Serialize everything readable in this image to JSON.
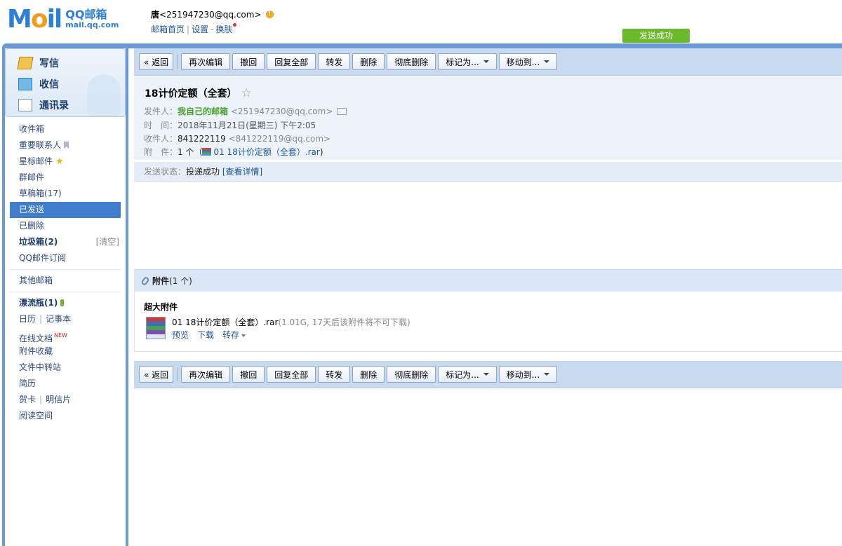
{
  "header": {
    "logo_mark_left": "M",
    "logo_mark_o": "o",
    "logo_mark_right": "il",
    "logo_cn": "QQ邮箱",
    "logo_en": "mail.qq.com",
    "user_name": "唐",
    "user_email": "<251947230@qq.com>",
    "links": [
      "邮箱首页",
      "设置",
      "换肤"
    ],
    "link_sep_bar": "|",
    "link_sep_dash": "-",
    "toast": "发送成功"
  },
  "quick_actions": [
    {
      "label": "写信",
      "icon": "pencil-icon"
    },
    {
      "label": "收信",
      "icon": "inbox-download-icon"
    },
    {
      "label": "通讯录",
      "icon": "contact-card-icon"
    }
  ],
  "folders": {
    "inbox": "收件箱",
    "important": "重要联系人",
    "starred": "星标邮件",
    "group": "群邮件",
    "drafts": "草稿箱(17)",
    "sent": "已发送",
    "deleted": "已删除",
    "spam": "垃圾箱(2)",
    "spam_clear": "[清空]",
    "subscriptions": "QQ邮件订阅",
    "other_mailboxes": "其他邮箱",
    "drift_bottle": "漂流瓶(1)",
    "calendar": "日历",
    "notes": "记事本",
    "online_docs": "在线文档",
    "new_tag": "NEW",
    "attachment_collection": "附件收藏",
    "file_transfer": "文件中转站",
    "resume": "简历",
    "greeting_card": "贺卡",
    "postcard": "明信片",
    "reading_space": "阅读空间",
    "pipe": "|"
  },
  "toolbar": {
    "back": "« 返回",
    "reedit": "再次编辑",
    "recall": "撤回",
    "reply_all": "回复全部",
    "forward": "转发",
    "delete": "删除",
    "delete_forever": "彻底删除",
    "mark_as": "标记为...",
    "move_to": "移动到..."
  },
  "mail": {
    "subject": "18计价定额（全套）",
    "star": "☆",
    "from_label": "发件人：",
    "from_name": "我自己的邮箱",
    "from_email": "<251947230@qq.com>",
    "time_label": "时　间：",
    "time_value": "2018年11月21日(星期三) 下午2:05",
    "to_label": "收件人：",
    "to_name": "841222119",
    "to_email": "<841222119@qq.com>",
    "attach_label": "附　件：",
    "attach_count": "1 个（",
    "attach_link": "01 18计价定额（全套）.rar",
    "attach_close": ")",
    "status_label": "发送状态：",
    "status_value": "投递成功",
    "status_link": "[查看详情]"
  },
  "attachments": {
    "header_label": "附件",
    "header_count": "(1 个)",
    "big_label": "超大附件",
    "file_name": "01 18计价定额（全套）.rar",
    "file_meta": "(1.01G, 17天后该附件将不可下载)",
    "actions": {
      "preview": "预览",
      "download": "下载",
      "save": "转存"
    }
  },
  "colors": {
    "accent": "#3f7cc9",
    "toolbar_bg": "#c8daf0",
    "success_green": "#6bb82a",
    "sender_green": "#4aa02c",
    "link_blue": "#1e5494"
  }
}
